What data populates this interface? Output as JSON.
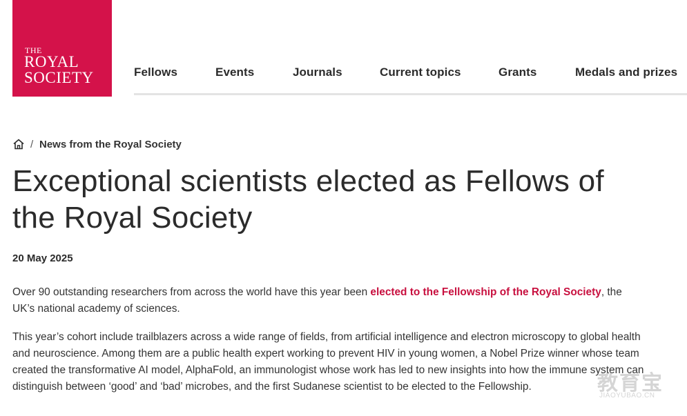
{
  "logo": {
    "line1": "THE",
    "line2": "ROYAL",
    "line3": "SOCIETY",
    "brand_color": "#d4124a"
  },
  "nav": {
    "items": [
      "Fellows",
      "Events",
      "Journals",
      "Current topics",
      "Grants",
      "Medals and prizes"
    ]
  },
  "breadcrumb": {
    "home_icon": "home-icon",
    "separator": "/",
    "current": "News from the Royal Society"
  },
  "article": {
    "title": "Exceptional scientists elected as Fellows of the Royal Society",
    "date": "20 May 2025",
    "p1_before": "Over 90 outstanding researchers from across the world have this year been ",
    "p1_link": "elected to the Fellowship of the Royal Society",
    "p1_after": ", the UK’s national academy of sciences.",
    "p2": "This year’s cohort include trailblazers across a wide range of fields, from artificial intelligence and electron microscopy to global health and neuroscience. Among them are a public health expert working to prevent HIV in young women, a Nobel Prize winner whose team created the transformative AI model, AlphaFold, an immunologist whose work has led to new insights into how the immune system can distinguish between ‘good’ and ‘bad’ microbes, and the first Sudanese scientist to be elected to the Fellowship."
  },
  "watermark": {
    "text_cn": "教育宝",
    "text_en": "JIAOYUBAO.CN"
  },
  "colors": {
    "link": "#c8103f",
    "text": "#2b2b2b",
    "nav_rule": "#e3e3e3"
  }
}
